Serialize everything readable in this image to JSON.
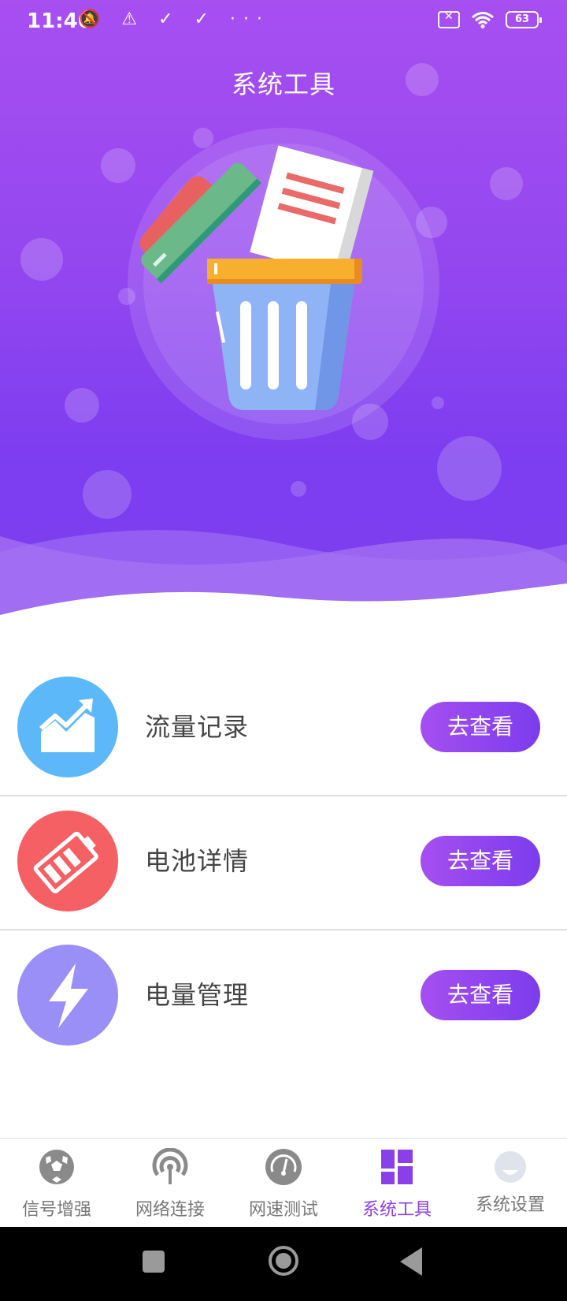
{
  "status_bar": {
    "time": "11:46",
    "left_icons": "🔕 ⚠ ✓ ✓ ···",
    "battery_level": "63"
  },
  "header": {
    "title": "系统工具"
  },
  "colors": {
    "accent": "#8a40e8",
    "traffic_icon_bg": "#5cb8f8",
    "battery_icon_bg": "#f46064",
    "power_icon_bg": "#9a8ff7"
  },
  "items": [
    {
      "label": "流量记录",
      "button": "去查看",
      "icon": "traffic-chart-icon"
    },
    {
      "label": "电池详情",
      "button": "去查看",
      "icon": "battery-icon"
    },
    {
      "label": "电量管理",
      "button": "去查看",
      "icon": "lightning-icon"
    }
  ],
  "bottom_nav": [
    {
      "label": "信号增强",
      "icon": "soccer-ball-icon",
      "active": false
    },
    {
      "label": "网络连接",
      "icon": "broadcast-icon",
      "active": false
    },
    {
      "label": "网速测试",
      "icon": "speedometer-icon",
      "active": false
    },
    {
      "label": "系统工具",
      "icon": "grid-icon",
      "active": true
    },
    {
      "label": "系统设置",
      "icon": "settings-face-icon",
      "active": false
    }
  ]
}
